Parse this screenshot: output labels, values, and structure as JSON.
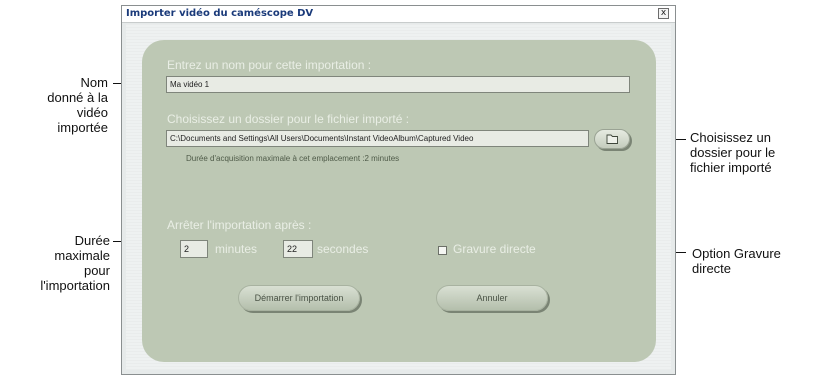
{
  "window": {
    "title": "Importer vidéo du caméscope DV",
    "close_label": "x"
  },
  "form": {
    "name_label": "Entrez un nom pour cette importation :",
    "name_value": "Ma vidéo 1",
    "folder_label": "Choisissez un dossier pour le fichier importé :",
    "folder_value": "C:\\Documents and Settings\\All Users\\Documents\\Instant VideoAlbum\\Captured Video",
    "max_duration_hint": "Durée d'acquisition maximale à cet emplacement :2 minutes",
    "stop_label": "Arrêter l'importation après :",
    "minutes_value": "2",
    "minutes_unit": "minutes",
    "seconds_value": "22",
    "seconds_unit": "secondes",
    "direct_burn_label": "Gravure directe",
    "direct_burn_checked": false
  },
  "buttons": {
    "start": "Démarrer l'importation",
    "cancel": "Annuler"
  },
  "icons": {
    "folder_button": "folder-icon"
  },
  "annotations": {
    "name": [
      "Nom",
      "donné à la",
      "vidéo",
      "importée"
    ],
    "duration": [
      "Durée",
      "maximale",
      "pour",
      "l'importation"
    ],
    "folder": [
      "Choisissez un",
      "dossier pour le",
      "fichier importé"
    ],
    "burn": [
      "Option Gravure",
      "directe"
    ]
  }
}
